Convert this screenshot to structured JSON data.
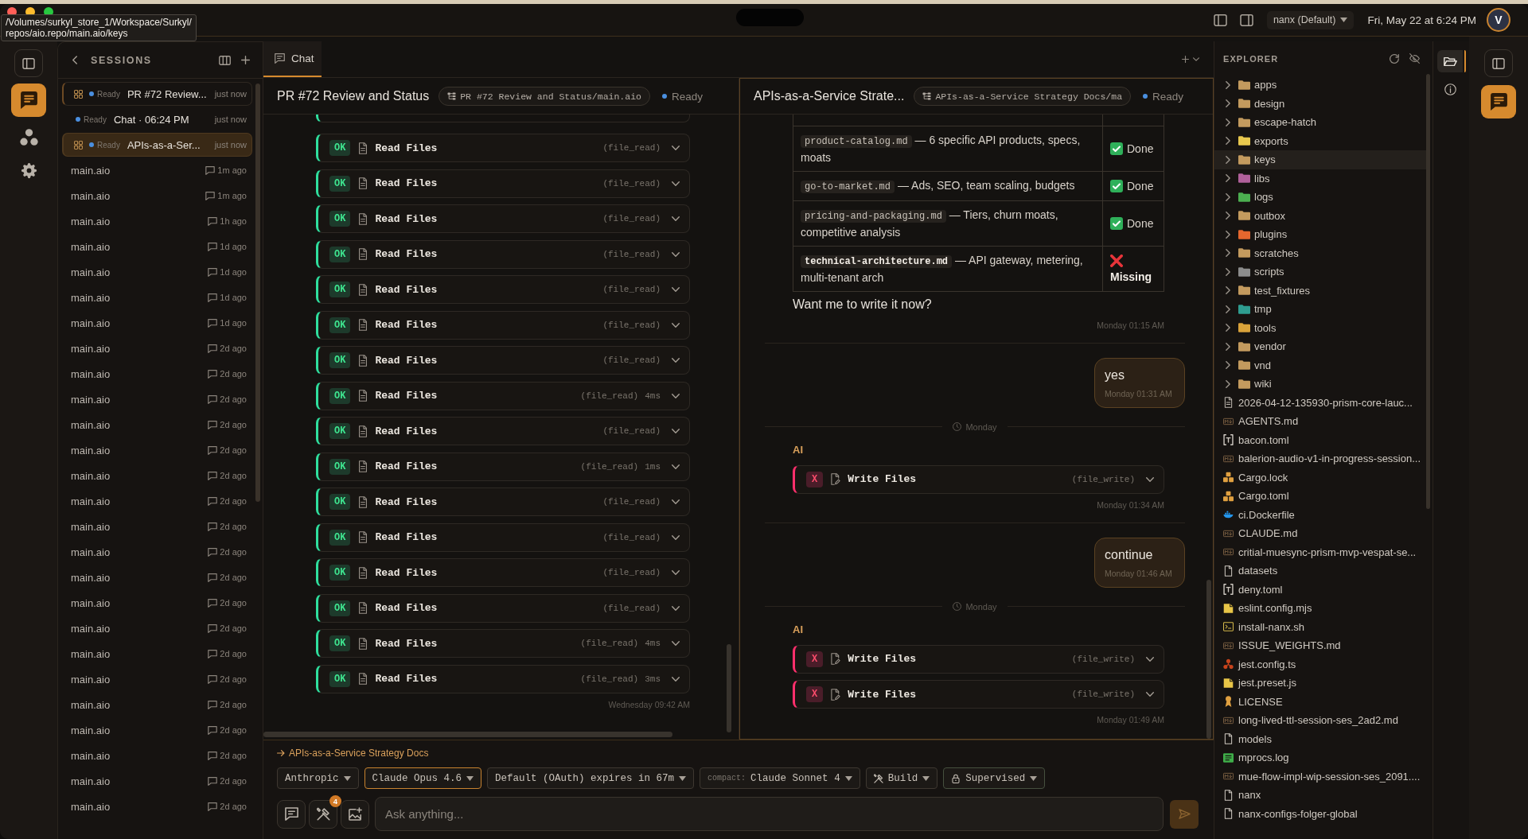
{
  "tooltip": {
    "text": "/Volumes/surkyl_store_1/Workspace/Surkyl/\nrepos/aio.repo/main.aio/keys"
  },
  "title_bar": {
    "profile": "nanx (Default)",
    "datetime": "Fri, May 22 at 6:24 PM",
    "avatar": "V"
  },
  "activity_bar": [
    {
      "kind": "panel",
      "selected": false
    },
    {
      "kind": "chat",
      "selected": true
    },
    {
      "kind": "agents",
      "selected": false
    },
    {
      "kind": "settings",
      "selected": false
    }
  ],
  "sessions": {
    "title": "SESSIONS",
    "items": [
      {
        "kind": "live",
        "open": true,
        "selected": false,
        "status": "Ready",
        "title": "PR #72 Review...",
        "time": "just now"
      },
      {
        "kind": "live",
        "open": false,
        "selected": false,
        "status": "Ready",
        "title": "Chat · 06:24 PM",
        "time": "just now"
      },
      {
        "kind": "live",
        "open": true,
        "selected": true,
        "status": "Ready",
        "title": "APIs-as-a-Ser...",
        "time": "just now"
      },
      {
        "kind": "history",
        "selected": false,
        "title": "main.aio",
        "time": "1m ago"
      },
      {
        "kind": "history",
        "selected": false,
        "title": "main.aio",
        "time": "1m ago"
      },
      {
        "kind": "history",
        "selected": false,
        "title": "main.aio",
        "time": "1h ago"
      },
      {
        "kind": "history",
        "selected": false,
        "title": "main.aio",
        "time": "1d ago"
      },
      {
        "kind": "history",
        "selected": false,
        "title": "main.aio",
        "time": "1d ago"
      },
      {
        "kind": "history",
        "selected": false,
        "title": "main.aio",
        "time": "1d ago"
      },
      {
        "kind": "history",
        "selected": false,
        "title": "main.aio",
        "time": "1d ago"
      },
      {
        "kind": "history",
        "selected": false,
        "title": "main.aio",
        "time": "2d ago"
      },
      {
        "kind": "history",
        "selected": false,
        "title": "main.aio",
        "time": "2d ago"
      },
      {
        "kind": "history",
        "selected": false,
        "title": "main.aio",
        "time": "2d ago"
      },
      {
        "kind": "history",
        "selected": false,
        "title": "main.aio",
        "time": "2d ago"
      },
      {
        "kind": "history",
        "selected": false,
        "title": "main.aio",
        "time": "2d ago"
      },
      {
        "kind": "history",
        "selected": false,
        "title": "main.aio",
        "time": "2d ago"
      },
      {
        "kind": "history",
        "selected": false,
        "title": "main.aio",
        "time": "2d ago"
      },
      {
        "kind": "history",
        "selected": false,
        "title": "main.aio",
        "time": "2d ago"
      },
      {
        "kind": "history",
        "selected": false,
        "title": "main.aio",
        "time": "2d ago"
      },
      {
        "kind": "history",
        "selected": false,
        "title": "main.aio",
        "time": "2d ago"
      },
      {
        "kind": "history",
        "selected": false,
        "title": "main.aio",
        "time": "2d ago"
      },
      {
        "kind": "history",
        "selected": false,
        "title": "main.aio",
        "time": "2d ago"
      },
      {
        "kind": "history",
        "selected": false,
        "title": "main.aio",
        "time": "2d ago"
      },
      {
        "kind": "history",
        "selected": false,
        "title": "main.aio",
        "time": "2d ago"
      },
      {
        "kind": "history",
        "selected": false,
        "title": "main.aio",
        "time": "2d ago"
      },
      {
        "kind": "history",
        "selected": false,
        "title": "main.aio",
        "time": "2d ago"
      },
      {
        "kind": "history",
        "selected": false,
        "title": "main.aio",
        "time": "2d ago"
      },
      {
        "kind": "history",
        "selected": false,
        "title": "main.aio",
        "time": "2d ago"
      },
      {
        "kind": "history",
        "selected": false,
        "title": "main.aio",
        "time": "2d ago"
      }
    ]
  },
  "tabs": [
    {
      "label": "Chat",
      "selected": true
    }
  ],
  "panes": [
    {
      "title": "PR #72 Review and Status",
      "path": "PR #72 Review and Status/main.aio",
      "status": "Ready",
      "focused": false,
      "messages": [
        {
          "kind": "assistant",
          "time": "Wednesday 09:42 AM",
          "blocks": [
            {
              "kind": "read",
              "ok": true,
              "badge": "OK",
              "title": "Read Files",
              "tool": "(file_read)"
            },
            {
              "kind": "read",
              "ok": true,
              "badge": "OK",
              "title": "Read Files",
              "tool": "(file_read)"
            },
            {
              "kind": "read",
              "ok": true,
              "badge": "OK",
              "title": "Read Files",
              "tool": "(file_read)"
            },
            {
              "kind": "read",
              "ok": true,
              "badge": "OK",
              "title": "Read Files",
              "tool": "(file_read)"
            },
            {
              "kind": "read",
              "ok": true,
              "badge": "OK",
              "title": "Read Files",
              "tool": "(file_read)"
            },
            {
              "kind": "read",
              "ok": true,
              "badge": "OK",
              "title": "Read Files",
              "tool": "(file_read)"
            },
            {
              "kind": "read",
              "ok": true,
              "badge": "OK",
              "title": "Read Files",
              "tool": "(file_read)"
            },
            {
              "kind": "read",
              "ok": true,
              "badge": "OK",
              "title": "Read Files",
              "tool": "(file_read)",
              "duration": "4ms"
            },
            {
              "kind": "read",
              "ok": true,
              "badge": "OK",
              "title": "Read Files",
              "tool": "(file_read)"
            },
            {
              "kind": "read",
              "ok": true,
              "badge": "OK",
              "title": "Read Files",
              "tool": "(file_read)",
              "duration": "1ms"
            },
            {
              "kind": "read",
              "ok": true,
              "badge": "OK",
              "title": "Read Files",
              "tool": "(file_read)"
            },
            {
              "kind": "read",
              "ok": true,
              "badge": "OK",
              "title": "Read Files",
              "tool": "(file_read)"
            },
            {
              "kind": "read",
              "ok": true,
              "badge": "OK",
              "title": "Read Files",
              "tool": "(file_read)"
            },
            {
              "kind": "read",
              "ok": true,
              "badge": "OK",
              "title": "Read Files",
              "tool": "(file_read)"
            },
            {
              "kind": "read",
              "ok": true,
              "badge": "OK",
              "title": "Read Files",
              "tool": "(file_read)",
              "duration": "4ms"
            },
            {
              "kind": "read",
              "ok": true,
              "badge": "OK",
              "title": "Read Files",
              "tool": "(file_read)",
              "duration": "3ms"
            }
          ]
        }
      ]
    },
    {
      "title": "APIs-as-a-Service Strate...",
      "path": "APIs-as-a-Service Strategy Docs/ma",
      "status": "Ready",
      "focused": true,
      "messages": [
        {
          "kind": "assistant",
          "time": "Monday 01:15 AM",
          "blocks": [
            {
              "kind": "table",
              "rows": [
                {
                  "file": "product-catalog.md",
                  "summary": "— 6 specific API products, specs, moats",
                  "done": true,
                  "status": "Done"
                },
                {
                  "file": "go-to-market.md",
                  "summary": "— Ads, SEO, team scaling, budgets",
                  "done": true,
                  "status": "Done"
                },
                {
                  "file": "pricing-and-packaging.md",
                  "summary": "— Tiers, churn moats, competitive analysis",
                  "done": true,
                  "status": "Done"
                },
                {
                  "file": "**technical-architecture.md**",
                  "summary": "— API gateway, metering, multi-tenant arch",
                  "done": false,
                  "status": "Missing"
                }
              ]
            },
            {
              "kind": "text",
              "text": "Want me to write it now?"
            }
          ]
        },
        {
          "kind": "user",
          "text": "yes",
          "time": "Monday 01:31 AM"
        },
        {
          "kind": "separator",
          "text": "Monday"
        },
        {
          "kind": "assistant",
          "label": "AI",
          "time": "Monday 01:34 AM",
          "blocks": [
            {
              "kind": "write",
              "ok": false,
              "badge": "X",
              "title": "Write Files",
              "tool": "(file_write)"
            }
          ]
        },
        {
          "kind": "user",
          "text": "continue",
          "time": "Monday 01:46 AM"
        },
        {
          "kind": "separator",
          "text": "Monday"
        },
        {
          "kind": "assistant",
          "label": "AI",
          "time": "Monday 01:49 AM",
          "blocks": [
            {
              "kind": "write",
              "ok": false,
              "badge": "X",
              "title": "Write Files",
              "tool": "(file_write)"
            },
            {
              "kind": "write",
              "ok": false,
              "badge": "X",
              "title": "Write Files",
              "tool": "(file_write)"
            }
          ]
        }
      ]
    }
  ],
  "composer": {
    "context": "APIs-as-a-Service Strategy Docs",
    "selectors": [
      {
        "kind": "plain",
        "label": "Anthropic",
        "selected": false
      },
      {
        "kind": "plain",
        "label": "Claude Opus 4.6",
        "selected": true
      },
      {
        "kind": "plain",
        "label": "Default (OAuth) expires in 67m",
        "selected": false
      },
      {
        "kind": "prefixed",
        "prefix": "compact:",
        "label": "Claude Sonnet 4",
        "selected": false
      },
      {
        "kind": "build",
        "label": "Build",
        "selected": false
      },
      {
        "kind": "lock",
        "label": "Supervised",
        "selected": false
      }
    ],
    "tool_count": "4",
    "placeholder": "Ask anything...",
    "send_disabled": true
  },
  "explorer": {
    "title": "EXPLORER",
    "items": [
      {
        "kind": "folder",
        "name": "apps",
        "color": "#c39a5e",
        "selected": false
      },
      {
        "kind": "folder",
        "name": "design",
        "color": "#c39a5e",
        "selected": false
      },
      {
        "kind": "folder",
        "name": "escape-hatch",
        "color": "#c39a5e",
        "selected": false
      },
      {
        "kind": "folder",
        "name": "exports",
        "color": "#e8c84e",
        "selected": false
      },
      {
        "kind": "folder",
        "name": "keys",
        "color": "#c39a5e",
        "selected": true
      },
      {
        "kind": "folder",
        "name": "libs",
        "color": "#b0609a",
        "selected": false
      },
      {
        "kind": "folder",
        "name": "logs",
        "color": "#4caf50",
        "selected": false
      },
      {
        "kind": "folder",
        "name": "outbox",
        "color": "#c39a5e",
        "selected": false
      },
      {
        "kind": "folder",
        "name": "plugins",
        "color": "#e5672e",
        "selected": false
      },
      {
        "kind": "folder",
        "name": "scratches",
        "color": "#c39a5e",
        "selected": false
      },
      {
        "kind": "folder",
        "name": "scripts",
        "color": "#8c8c8c",
        "selected": false
      },
      {
        "kind": "folder",
        "name": "test_fixtures",
        "color": "#c39a5e",
        "selected": false
      },
      {
        "kind": "folder",
        "name": "tmp",
        "color": "#2f9d90",
        "selected": false
      },
      {
        "kind": "folder",
        "name": "tools",
        "color": "#d9a23a",
        "selected": false
      },
      {
        "kind": "folder",
        "name": "vendor",
        "color": "#c39a5e",
        "selected": false
      },
      {
        "kind": "folder",
        "name": "vnd",
        "color": "#c39a5e",
        "selected": false
      },
      {
        "kind": "folder",
        "name": "wiki",
        "color": "#c39a5e",
        "selected": false
      },
      {
        "kind": "doc",
        "name": "2026-04-12-135930-prism-core-lauc...",
        "selected": false
      },
      {
        "kind": "markdown",
        "name": "AGENTS.md",
        "selected": false
      },
      {
        "kind": "toml",
        "name": "bacon.toml",
        "selected": false
      },
      {
        "kind": "markdown",
        "name": "balerion-audio-v1-in-progress-session...",
        "selected": false
      },
      {
        "kind": "cargo",
        "name": "Cargo.lock",
        "selected": false
      },
      {
        "kind": "cargo",
        "name": "Cargo.toml",
        "selected": false
      },
      {
        "kind": "docker",
        "name": "ci.Dockerfile",
        "selected": false
      },
      {
        "kind": "markdown",
        "name": "CLAUDE.md",
        "selected": false
      },
      {
        "kind": "markdown",
        "name": "critial-muesync-prism-mvp-vespat-se...",
        "selected": false
      },
      {
        "kind": "file",
        "name": "datasets",
        "selected": false
      },
      {
        "kind": "toml",
        "name": "deny.toml",
        "selected": false
      },
      {
        "kind": "js",
        "name": "eslint.config.mjs",
        "selected": false
      },
      {
        "kind": "shell",
        "name": "install-nanx.sh",
        "selected": false
      },
      {
        "kind": "markdown",
        "name": "ISSUE_WEIGHTS.md",
        "selected": false
      },
      {
        "kind": "jest",
        "name": "jest.config.ts",
        "selected": false
      },
      {
        "kind": "js",
        "name": "jest.preset.js",
        "selected": false
      },
      {
        "kind": "license",
        "name": "LICENSE",
        "selected": false
      },
      {
        "kind": "markdown",
        "name": "long-lived-ttl-session-ses_2ad2.md",
        "selected": false
      },
      {
        "kind": "file",
        "name": "models",
        "selected": false
      },
      {
        "kind": "log",
        "name": "mprocs.log",
        "selected": false
      },
      {
        "kind": "markdown",
        "name": "mue-flow-impl-wip-session-ses_2091....",
        "selected": false
      },
      {
        "kind": "file",
        "name": "nanx",
        "selected": false
      },
      {
        "kind": "file",
        "name": "nanx-configs-folger-global",
        "selected": false
      }
    ]
  },
  "explorer_rail": [
    {
      "kind": "files",
      "selected": true
    },
    {
      "kind": "info",
      "selected": false
    }
  ],
  "right_rail": [
    {
      "kind": "panel",
      "selected": false
    },
    {
      "kind": "chat",
      "selected": true
    }
  ]
}
